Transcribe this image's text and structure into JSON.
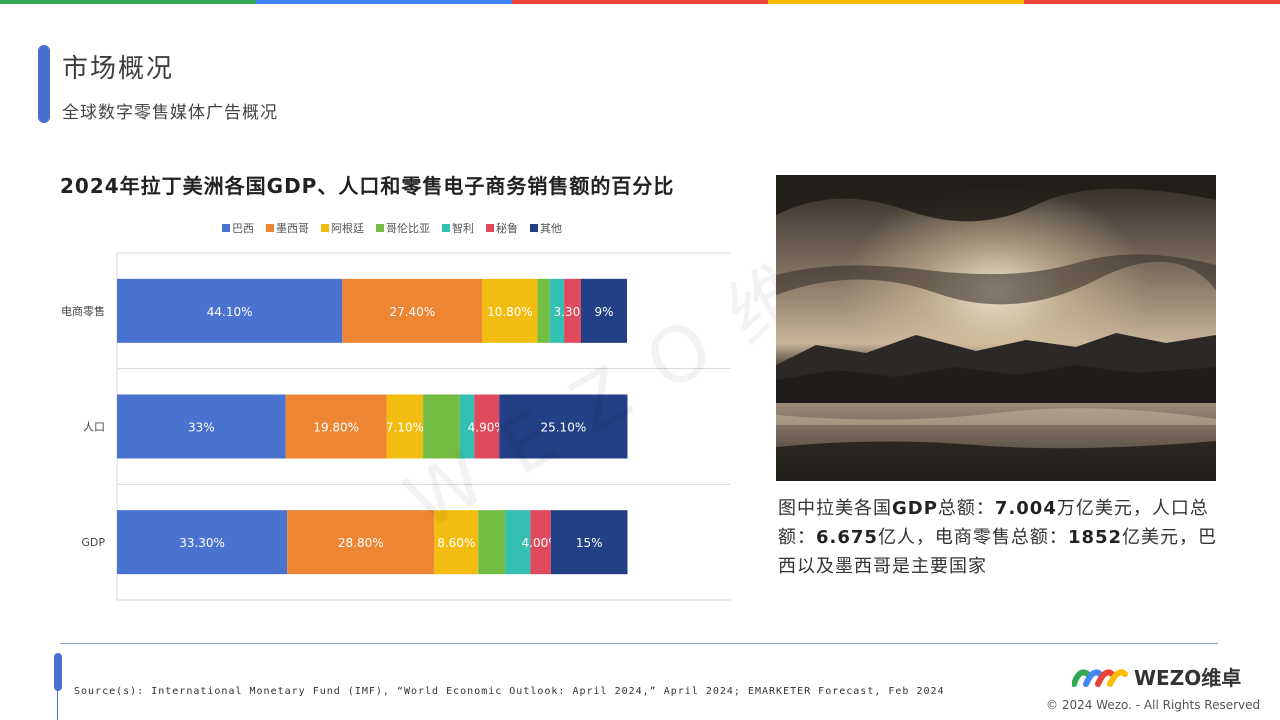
{
  "header": {
    "title": "市场概况",
    "subtitle": "全球数字零售媒体广告概况"
  },
  "chart_data": {
    "type": "bar",
    "orientation": "horizontal",
    "stacked": true,
    "title": "2024年拉丁美洲各国GDP、人口和零售电子商务销售额的百分比",
    "categories": [
      "电商零售",
      "人口",
      "GDP"
    ],
    "series": [
      {
        "name": "巴西",
        "color": "#4a72d0",
        "values": [
          44.1,
          33,
          33.3
        ],
        "labels": [
          "44.10%",
          "33%",
          "33.30%"
        ]
      },
      {
        "name": "墨西哥",
        "color": "#ee8532",
        "values": [
          27.4,
          19.8,
          28.8
        ],
        "labels": [
          "27.40%",
          "19.80%",
          "28.80%"
        ]
      },
      {
        "name": "阿根廷",
        "color": "#f2bc10",
        "values": [
          10.8,
          7.1,
          8.6
        ],
        "labels": [
          "10.80%",
          "7.10%",
          "8.60%"
        ]
      },
      {
        "name": "哥伦比亚",
        "color": "#73bd44",
        "values": [
          2.4,
          7.2,
          5.3
        ],
        "labels": [
          "",
          "",
          ""
        ]
      },
      {
        "name": "智利",
        "color": "#34c0b2",
        "values": [
          2.8,
          2.8,
          4.9
        ],
        "labels": [
          "",
          "",
          ""
        ]
      },
      {
        "name": "秘鲁",
        "color": "#e04a5e",
        "values": [
          3.3,
          4.9,
          4
        ],
        "labels": [
          "3.30%",
          "4.90%",
          "4.00%"
        ]
      },
      {
        "name": "其他",
        "color": "#233f85",
        "values": [
          9,
          25.1,
          15
        ],
        "labels": [
          "9%",
          "25.10%",
          "15%"
        ]
      }
    ],
    "xlim": [
      0,
      100
    ],
    "legend": "top",
    "grid": false
  },
  "caption": {
    "p1": "图中拉美各国",
    "gdp_label": "GDP",
    "p2": "总额：",
    "gdp_value": "7.004",
    "p3": "万亿美元，人口总额：",
    "pop_value": "6.675",
    "p4": "亿人，电商零售总额：",
    "ecom_value": "1852",
    "p5": "亿美元，巴西以及墨西哥是主要国家"
  },
  "watermark": "WEZO维卓",
  "footer": {
    "source": "Source(s): International Monetary Fund (IMF), “World Economic Outlook: April 2024,” April 2024; EMARKETER Forecast, Feb 2024",
    "logo_text": "WEZO维卓",
    "copyright": "© 2024 Wezo. - All Rights Reserved"
  },
  "colors": {
    "accent": "#4a6fd1",
    "topbar": [
      "#34a853",
      "#4285f4",
      "#ea4335",
      "#fbbc05",
      "#ea4335"
    ]
  }
}
